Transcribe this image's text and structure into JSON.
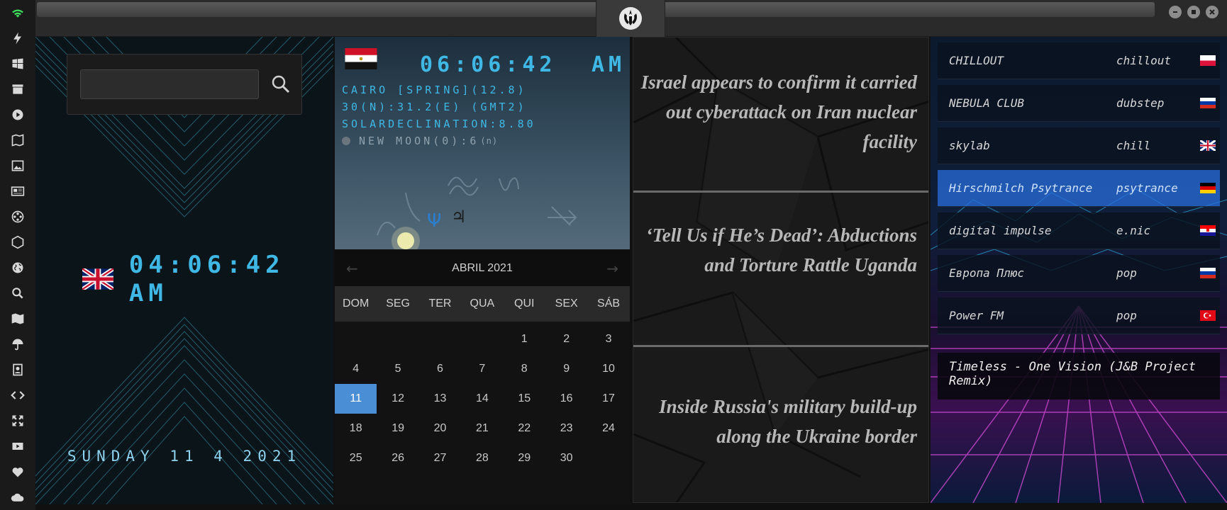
{
  "colors": {
    "lcd": "#3fb8e6",
    "accent": "#4a8fd6",
    "active_station": "#2a6edc"
  },
  "sidebar": {
    "icons": [
      "wifi-icon",
      "bolt-icon",
      "windows-icon",
      "archive-icon",
      "play-icon",
      "map-book-icon",
      "image-icon",
      "news-icon",
      "film-reel-icon",
      "hexagon-icon",
      "globe-icon",
      "search-icon",
      "map-icon",
      "umbrella-icon",
      "contact-icon",
      "code-icon",
      "expand-icon",
      "youtube-icon",
      "heart-icon",
      "cloud-icon"
    ]
  },
  "local_clock": {
    "time": "04:06:42 AM",
    "date": "SUNDAY 11 4 2021",
    "flag": "uk-flag"
  },
  "search": {
    "placeholder": "",
    "value": ""
  },
  "city": {
    "flag": "egypt-flag",
    "time": "06:06:42",
    "ampm": "AM",
    "line1": "CAIRO [SPRING](12.8)",
    "line2": "30(N):31.2(E) (GMT2)",
    "line3": "SOLARDECLINATION:8.80",
    "moon": "NEW MOON(0):6",
    "moon_suffix": "(n)"
  },
  "calendar": {
    "month": "ABRIL 2021",
    "prev": "←",
    "next": "→",
    "weekdays": [
      "DOM",
      "SEG",
      "TER",
      "QUA",
      "QUI",
      "SEX",
      "SÁB"
    ],
    "leading_blanks": 4,
    "days": [
      "1",
      "2",
      "3",
      "4",
      "5",
      "6",
      "7",
      "8",
      "9",
      "10",
      "11",
      "12",
      "13",
      "14",
      "15",
      "16",
      "17",
      "18",
      "19",
      "20",
      "21",
      "22",
      "23",
      "24",
      "25",
      "26",
      "27",
      "28",
      "29",
      "30"
    ],
    "today": "11"
  },
  "news": [
    "Israel appears to confirm it carried out cyberattack on Iran nuclear facility",
    "‘Tell Us if He’s Dead’: Abductions and Torture Rattle Uganda",
    "Inside Russia's military build-up along the Ukraine border"
  ],
  "stations": [
    {
      "name": "CHILLOUT",
      "genre": "chillout",
      "flag": "poland-flag"
    },
    {
      "name": "NEBULA CLUB",
      "genre": "dubstep",
      "flag": "russia-flag"
    },
    {
      "name": "skylab",
      "genre": "chill",
      "flag": "uk-flag"
    },
    {
      "name": "Hirschmilch Psytrance",
      "genre": "psytrance",
      "flag": "germany-flag",
      "active": true
    },
    {
      "name": "digital impulse",
      "genre": "e.nic",
      "flag": "croatia-flag"
    },
    {
      "name": "Европа Плюс",
      "genre": "pop",
      "flag": "russia-flag"
    },
    {
      "name": "Power FM",
      "genre": "pop",
      "flag": "turkey-flag"
    }
  ],
  "now_playing": "Timeless - One Vision (J&B Project Remix)"
}
